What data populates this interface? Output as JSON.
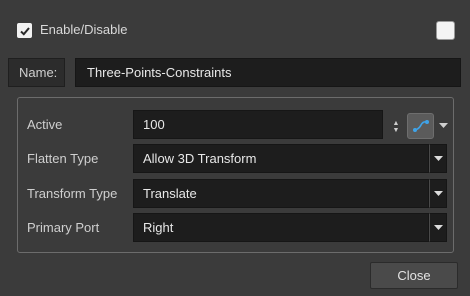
{
  "header": {
    "enable_label": "Enable/Disable",
    "enable_checked": true,
    "color_swatch": "#f4f4f4"
  },
  "name_row": {
    "label": "Name:",
    "value": "Three-Points-Constraints"
  },
  "fields": {
    "active": {
      "label": "Active",
      "value": "100"
    },
    "flatten_type": {
      "label": "Flatten Type",
      "value": "Allow 3D Transform"
    },
    "transform_type": {
      "label": "Transform Type",
      "value": "Translate"
    },
    "primary_port": {
      "label": "Primary Port",
      "value": "Right"
    }
  },
  "icons": {
    "function_icon": "function-curve-icon",
    "dropdown_icon": "chevron-down-icon",
    "spin_icon": "spin-arrows-icon"
  },
  "buttons": {
    "close_label": "Close"
  },
  "colors": {
    "background": "#3b3b3b",
    "field_bg": "#1d1d1d",
    "check_bg": "#f2f2f2",
    "func_accent": "#3fa3e8"
  }
}
